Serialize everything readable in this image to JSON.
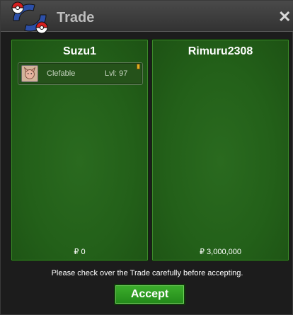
{
  "window": {
    "title": "Trade"
  },
  "left_panel": {
    "player": "Suzu1",
    "item": {
      "name": "Clefable",
      "level": "Lvl: 97"
    },
    "money": "₽ 0"
  },
  "right_panel": {
    "player": "Rimuru2308",
    "money": "₽ 3,000,000"
  },
  "notice": "Please check over the Trade carefully before accepting.",
  "accept_label": "Accept",
  "colors": {
    "panel_green": "#236019",
    "accept_green": "#2f9c23",
    "title_gray": "#bdbdbd"
  }
}
